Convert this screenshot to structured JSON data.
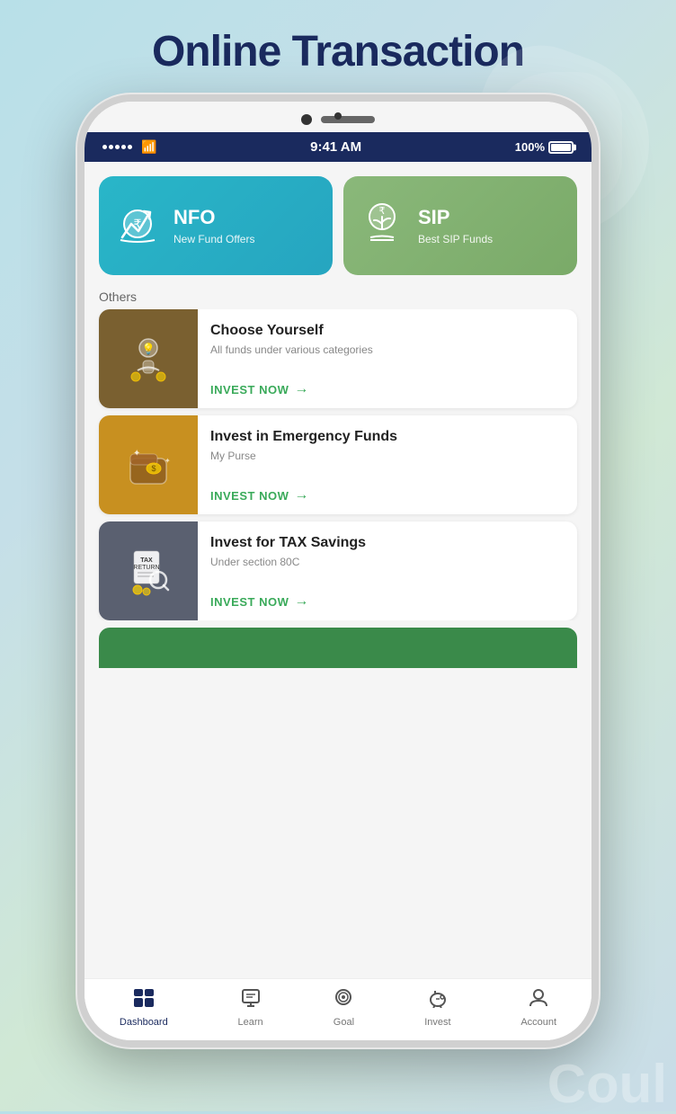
{
  "page": {
    "title": "Online Transaction",
    "background_color": "#b8e0e8"
  },
  "status_bar": {
    "time": "9:41 AM",
    "battery": "100%"
  },
  "top_cards": [
    {
      "id": "nfo",
      "title": "NFO",
      "subtitle": "New Fund Offers",
      "bg_color": "#29b6c8"
    },
    {
      "id": "sip",
      "title": "SIP",
      "subtitle": "Best SIP Funds",
      "bg_color": "#8ab87a"
    }
  ],
  "others_label": "Others",
  "invest_items": [
    {
      "id": "choose-yourself",
      "title": "Choose Yourself",
      "subtitle": "All funds under various categories",
      "cta": "INVEST NOW",
      "thumb_color": "#7a6030"
    },
    {
      "id": "emergency-funds",
      "title": "Invest in Emergency Funds",
      "subtitle": "My Purse",
      "cta": "INVEST NOW",
      "thumb_color": "#c89020"
    },
    {
      "id": "tax-savings",
      "title": "Invest for TAX Savings",
      "subtitle": "Under section 80C",
      "cta": "INVEST NOW",
      "thumb_color": "#5a6070"
    }
  ],
  "nav": {
    "items": [
      {
        "id": "dashboard",
        "label": "Dashboard",
        "active": true
      },
      {
        "id": "learn",
        "label": "Learn",
        "active": false
      },
      {
        "id": "goal",
        "label": "Goal",
        "active": false
      },
      {
        "id": "invest",
        "label": "Invest",
        "active": false
      },
      {
        "id": "account",
        "label": "Account",
        "active": false
      }
    ]
  },
  "corner_text": "Coul"
}
